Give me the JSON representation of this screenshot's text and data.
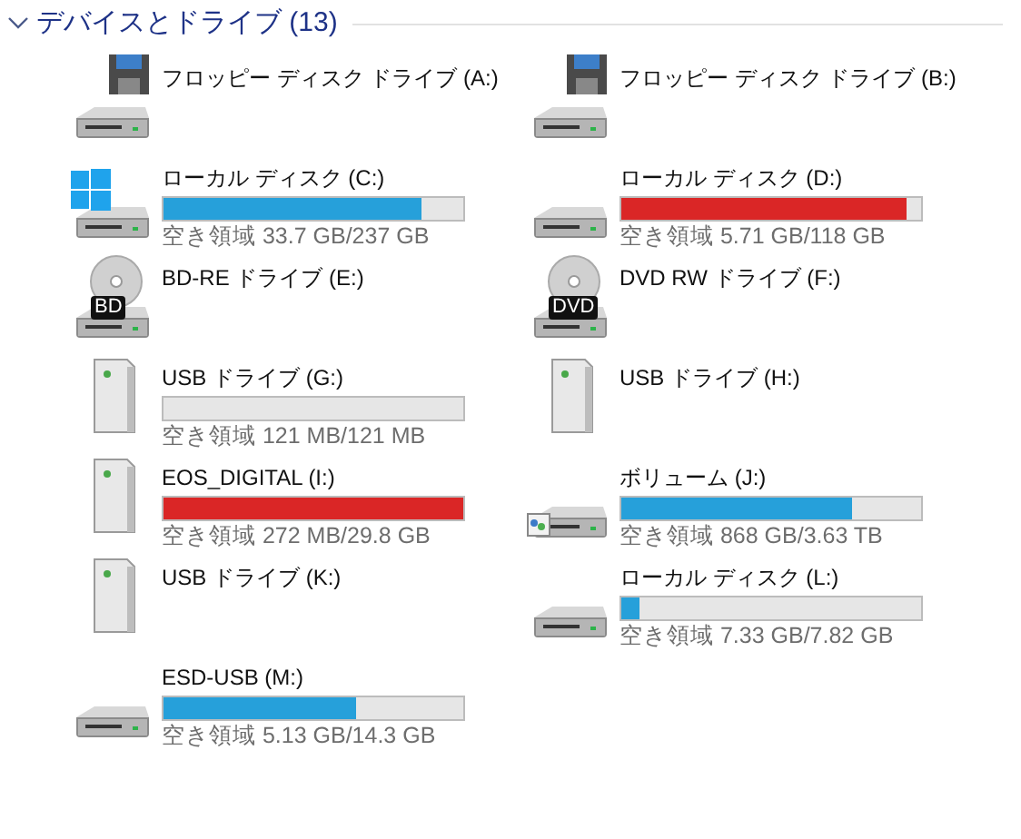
{
  "group": {
    "title": "デバイスとドライブ (13)",
    "expanded": true
  },
  "drives": [
    {
      "name": "フロッピー ディスク ドライブ (A:)",
      "kind": "floppy"
    },
    {
      "name": "フロッピー ディスク ドライブ (B:)",
      "kind": "floppy"
    },
    {
      "name": "ローカル ディスク (C:)",
      "kind": "system",
      "level": 0.86,
      "low_space": false,
      "free": "空き領域 33.7 GB/237 GB"
    },
    {
      "name": "ローカル ディスク (D:)",
      "kind": "hdd",
      "level": 0.95,
      "low_space": true,
      "free": "空き領域 5.71 GB/118 GB"
    },
    {
      "name": "BD-RE ドライブ (E:)",
      "kind": "disc",
      "disc_label": "BD"
    },
    {
      "name": "DVD RW ドライブ (F:)",
      "kind": "disc",
      "disc_label": "DVD"
    },
    {
      "name": "USB ドライブ (G:)",
      "kind": "usb",
      "level": 0,
      "free": "空き領域 121 MB/121 MB"
    },
    {
      "name": "USB ドライブ (H:)",
      "kind": "usb"
    },
    {
      "name": "EOS_DIGITAL (I:)",
      "kind": "usb",
      "level": 1,
      "low_space": true,
      "free": "空き領域 272 MB/29.8 GB"
    },
    {
      "name": "ボリューム (J:)",
      "kind": "network",
      "level": 0.77,
      "low_space": false,
      "free": "空き領域 868 GB/3.63 TB"
    },
    {
      "name": "USB ドライブ (K:)",
      "kind": "usb"
    },
    {
      "name": "ローカル ディスク (L:)",
      "kind": "hdd",
      "level": 0.06,
      "low_space": false,
      "free": "空き領域 7.33 GB/7.82 GB"
    },
    {
      "name": "ESD-USB (M:)",
      "kind": "hdd",
      "level": 0.64,
      "low_space": false,
      "free": "空き領域 5.13 GB/14.3 GB"
    }
  ]
}
